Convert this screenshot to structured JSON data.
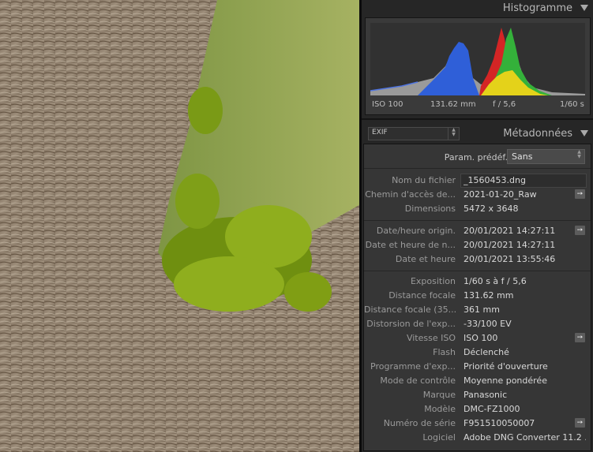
{
  "histogram": {
    "title": "Histogramme",
    "iso": "ISO 100",
    "focal": "131.62 mm",
    "aperture": "f / 5,6",
    "shutter": "1/60 s"
  },
  "metadata": {
    "title": "Métadonnées",
    "view_select": "EXIF",
    "preset_label": "Param. prédéf.",
    "preset_value": "Sans",
    "rows": [
      {
        "label": "Nom du fichier",
        "value": "_1560453.dng"
      },
      {
        "label": "Chemin d'accès de...",
        "value": "2021-01-20_Raw"
      },
      {
        "label": "Dimensions",
        "value": "5472 x 3648"
      },
      {
        "label": "Date/heure origin.",
        "value": "20/01/2021 14:27:11"
      },
      {
        "label": "Date et heure de n...",
        "value": "20/01/2021 14:27:11"
      },
      {
        "label": "Date et heure",
        "value": "20/01/2021 13:55:46"
      },
      {
        "label": "Exposition",
        "value": "1/60 s à f / 5,6"
      },
      {
        "label": "Distance focale",
        "value": "131.62 mm"
      },
      {
        "label": "Distance focale (35...",
        "value": "361 mm"
      },
      {
        "label": "Distorsion de l'exp...",
        "value": "-33/100 EV"
      },
      {
        "label": "Vitesse ISO",
        "value": "ISO 100"
      },
      {
        "label": "Flash",
        "value": "Déclenché"
      },
      {
        "label": "Programme d'exp...",
        "value": "Priorité d'ouverture"
      },
      {
        "label": "Mode de contrôle",
        "value": "Moyenne pondérée"
      },
      {
        "label": "Marque",
        "value": "Panasonic"
      },
      {
        "label": "Modèle",
        "value": "DMC-FZ1000"
      },
      {
        "label": "Numéro de série",
        "value": "F951510050007"
      },
      {
        "label": "Logiciel",
        "value": "Adobe DNG Converter 11.2 ..."
      }
    ]
  },
  "colors": {
    "panel": "#262626",
    "accent_blue": "#2f5fd8",
    "accent_red": "#d42525",
    "accent_green": "#34b13a",
    "accent_yellow": "#e4d21a"
  },
  "icons": {
    "collapse": "triangle-down-icon",
    "goto": "arrow-right-icon"
  }
}
